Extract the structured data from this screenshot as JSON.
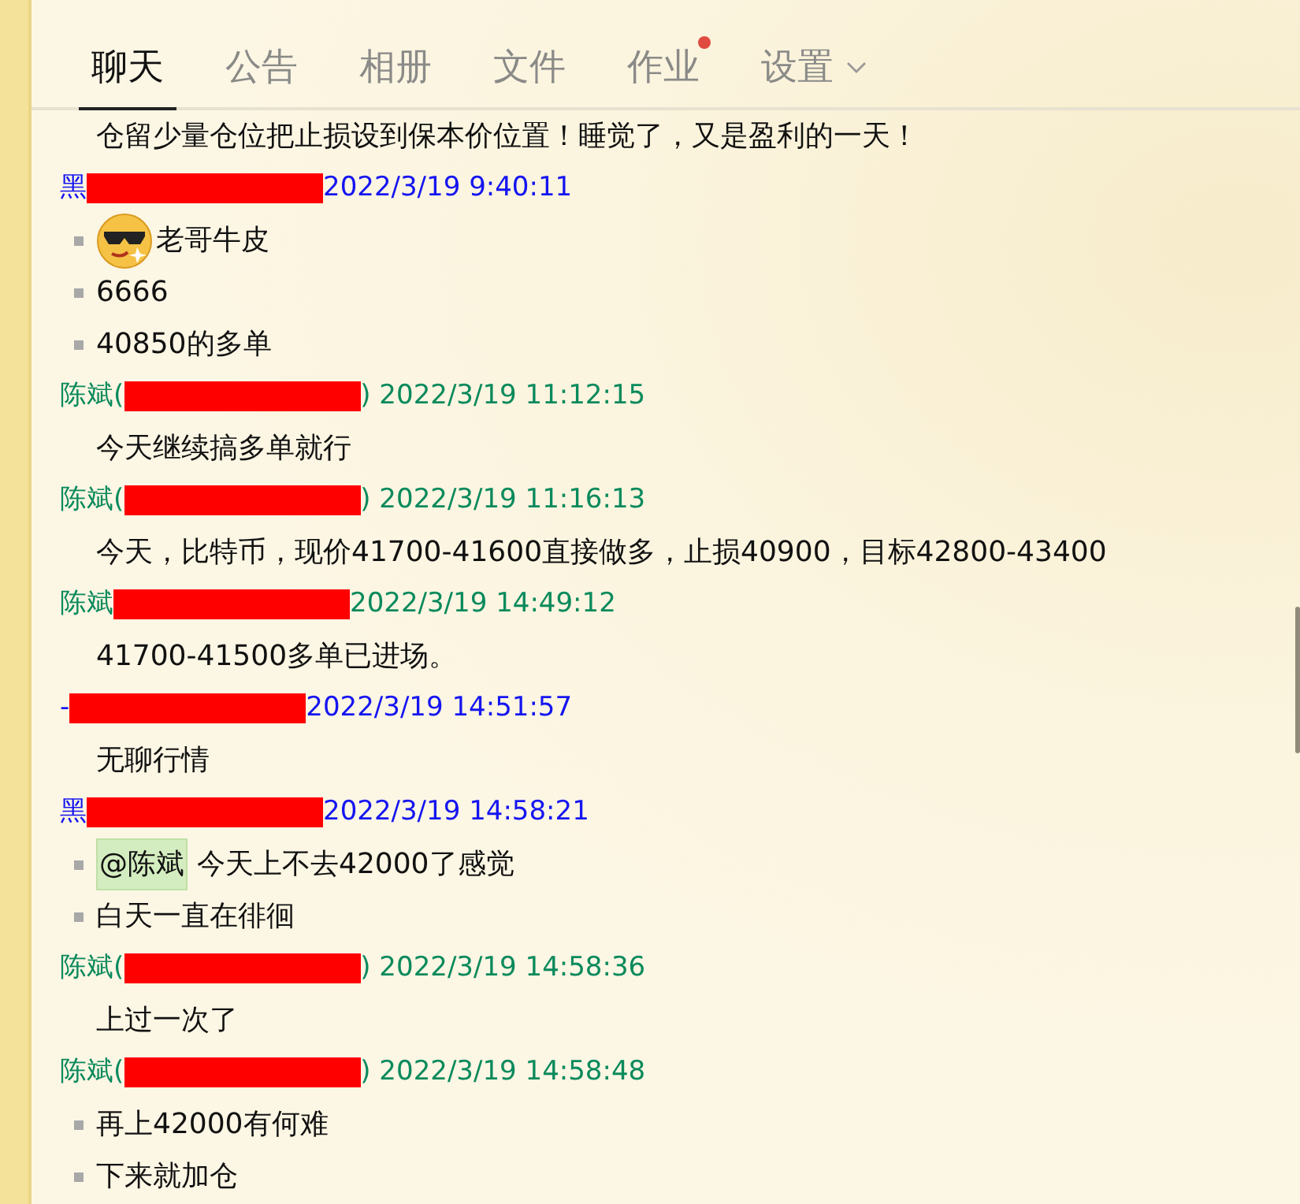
{
  "tabs": [
    {
      "label": "聊天",
      "selected": true,
      "notification": false,
      "dropdown": false
    },
    {
      "label": "公告",
      "selected": false,
      "notification": false,
      "dropdown": false
    },
    {
      "label": "相册",
      "selected": false,
      "notification": false,
      "dropdown": false
    },
    {
      "label": "文件",
      "selected": false,
      "notification": false,
      "dropdown": false
    },
    {
      "label": "作业",
      "selected": false,
      "notification": true,
      "dropdown": false
    },
    {
      "label": "设置",
      "selected": false,
      "notification": false,
      "dropdown": true
    }
  ],
  "messages": [
    {
      "lines": [
        {
          "kind": "plain",
          "text": "仓留少量仓位把止损设到保本价位置！睡觉了，又是盈利的一天！"
        }
      ]
    },
    {
      "sender": {
        "name": "黑",
        "time": "2022/3/19 9:40:11",
        "color": "#1515f0"
      },
      "lines": [
        {
          "kind": "emoji",
          "text": "老哥牛皮"
        },
        {
          "kind": "bullet",
          "text": "6666"
        },
        {
          "kind": "bullet",
          "text": "40850的多单"
        }
      ]
    },
    {
      "sender": {
        "name": "陈斌(",
        "suffix": ")",
        "time": "2022/3/19 11:12:15",
        "color": "#0a8a5c"
      },
      "lines": [
        {
          "kind": "plain",
          "text": "今天继续搞多单就行"
        }
      ]
    },
    {
      "sender": {
        "name": "陈斌(",
        "suffix": ")",
        "time": "2022/3/19 11:16:13",
        "color": "#0a8a5c"
      },
      "lines": [
        {
          "kind": "plain",
          "text": "今天，比特币，现价41700-41600直接做多，止损40900，目标42800-43400"
        }
      ]
    },
    {
      "sender": {
        "name": "陈斌",
        "time": "2022/3/19 14:49:12",
        "color": "#0a8a5c"
      },
      "lines": [
        {
          "kind": "plain",
          "text": "41700-41500多单已进场。"
        }
      ]
    },
    {
      "sender": {
        "name": "-",
        "time": "2022/3/19 14:51:57",
        "color": "#1515f0"
      },
      "lines": [
        {
          "kind": "plain",
          "text": "无聊行情"
        }
      ]
    },
    {
      "sender": {
        "name": "黑",
        "time": "2022/3/19 14:58:21",
        "color": "#1515f0"
      },
      "lines": [
        {
          "kind": "bullet",
          "mention": "@陈斌",
          "text": "今天上不去42000了感觉"
        },
        {
          "kind": "bullet",
          "text": "白天一直在徘徊"
        }
      ]
    },
    {
      "sender": {
        "name": "陈斌(",
        "suffix": ")",
        "time": "2022/3/19 14:58:36",
        "color": "#0a8a5c"
      },
      "lines": [
        {
          "kind": "plain",
          "text": "上过一次了"
        }
      ]
    },
    {
      "sender": {
        "name": "陈斌(",
        "suffix": ")",
        "time": "2022/3/19 14:58:48",
        "color": "#0a8a5c"
      },
      "lines": [
        {
          "kind": "bullet",
          "text": "再上42000有何难"
        },
        {
          "kind": "bullet",
          "text": "下来就加仓"
        }
      ]
    }
  ]
}
